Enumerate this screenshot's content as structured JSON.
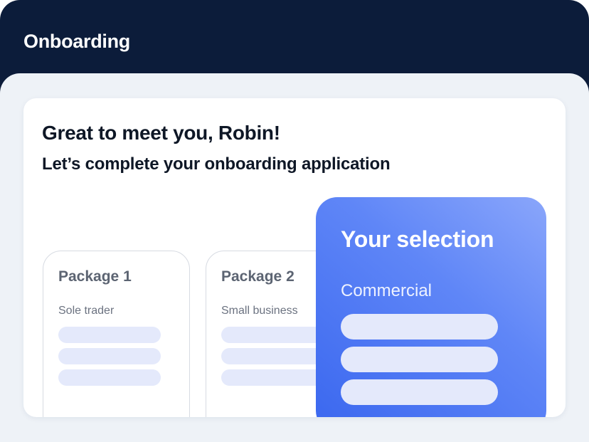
{
  "header": {
    "title": "Onboarding"
  },
  "main": {
    "greeting": "Great to meet you, Robin!",
    "subheading": "Let’s complete your onboarding application",
    "packages": [
      {
        "title": "Package 1",
        "subtitle": "Sole trader",
        "placeholder_lines": 3
      },
      {
        "title": "Package 2",
        "subtitle": "Small business",
        "placeholder_lines": 3
      }
    ],
    "selection": {
      "title": "Your selection",
      "value": "Commercial",
      "placeholder_lines": 3
    }
  },
  "colors": {
    "header_bg": "#0c1c3a",
    "content_bg": "#eef2f7",
    "card_bg": "#ffffff",
    "heading_text": "#0e1726",
    "package_title": "#5c6472",
    "placeholder_bar": "#e4e9fb",
    "selection_gradient_start": "#8aa6fb",
    "selection_gradient_end": "#3a67ef"
  }
}
